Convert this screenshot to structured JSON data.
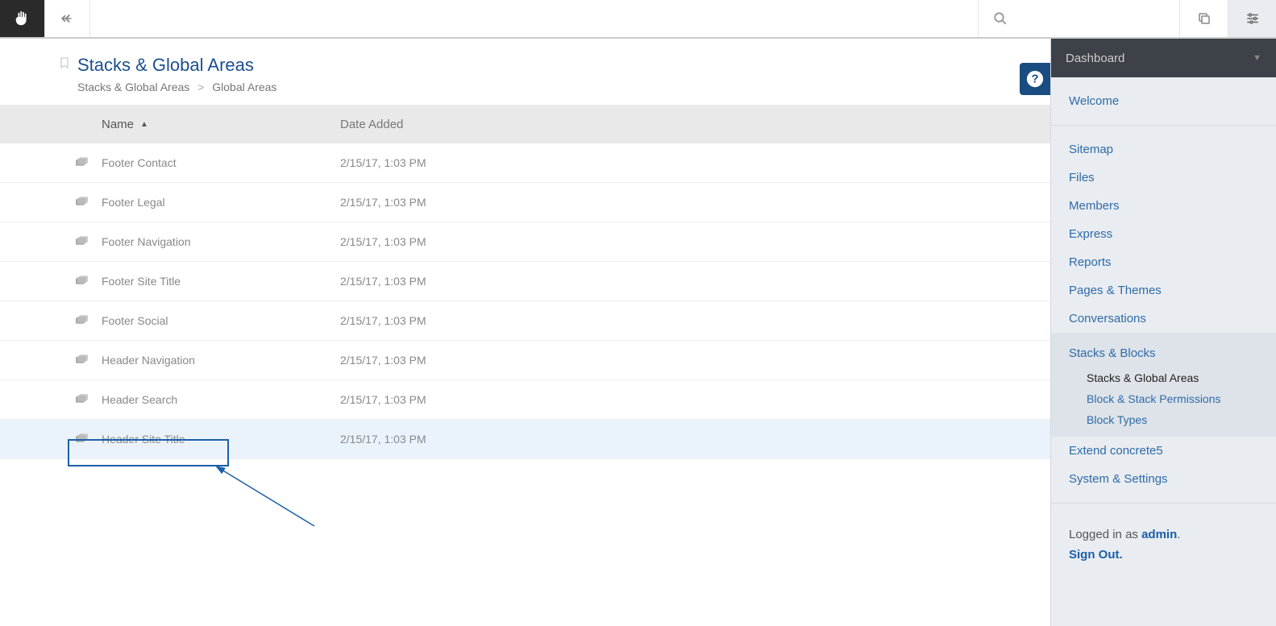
{
  "toolbar": {},
  "page": {
    "title": "Stacks & Global Areas",
    "breadcrumb_parent": "Stacks & Global Areas",
    "breadcrumb_sep": ">",
    "breadcrumb_current": "Global Areas"
  },
  "table": {
    "columns": {
      "name": "Name",
      "date": "Date Added"
    },
    "rows": [
      {
        "name": "Footer Contact",
        "date": "2/15/17, 1:03 PM"
      },
      {
        "name": "Footer Legal",
        "date": "2/15/17, 1:03 PM"
      },
      {
        "name": "Footer Navigation",
        "date": "2/15/17, 1:03 PM"
      },
      {
        "name": "Footer Site Title",
        "date": "2/15/17, 1:03 PM"
      },
      {
        "name": "Footer Social",
        "date": "2/15/17, 1:03 PM"
      },
      {
        "name": "Header Navigation",
        "date": "2/15/17, 1:03 PM"
      },
      {
        "name": "Header Search",
        "date": "2/15/17, 1:03 PM"
      },
      {
        "name": "Header Site Title",
        "date": "2/15/17, 1:03 PM"
      }
    ],
    "selected_index": 7
  },
  "sidebar": {
    "header": "Dashboard",
    "welcome": "Welcome",
    "nav": [
      "Sitemap",
      "Files",
      "Members",
      "Express",
      "Reports",
      "Pages & Themes",
      "Conversations"
    ],
    "active_group": {
      "label": "Stacks & Blocks",
      "items": [
        "Stacks & Global Areas",
        "Block & Stack Permissions",
        "Block Types"
      ],
      "current_index": 0
    },
    "nav_after": [
      "Extend concrete5",
      "System & Settings"
    ],
    "footer": {
      "prefix": "Logged in as ",
      "user": "admin",
      "suffix": ".",
      "signout": "Sign Out."
    }
  }
}
